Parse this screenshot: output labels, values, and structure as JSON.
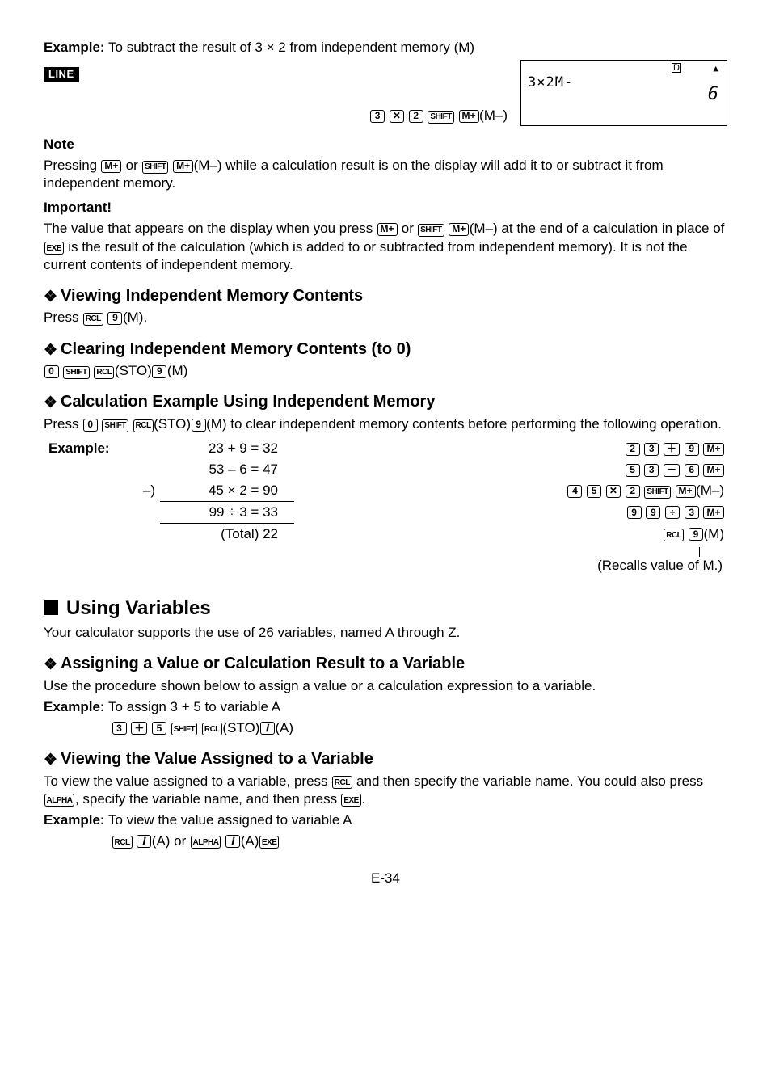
{
  "example_intro": {
    "label": "Example:",
    "text": " To subtract the result of 3 × 2 from independent memory (M)"
  },
  "line_badge": "LINE",
  "keyseq1_suffix": "(M–)",
  "screen": {
    "d": "D",
    "up": "▲",
    "line1": "3×2M-",
    "line2": "6"
  },
  "note": {
    "heading": "Note",
    "p1a": "Pressing ",
    "p1b": " or ",
    "p1c": "(M–) while a calculation result is on the display will add it to or subtract it from independent memory."
  },
  "important": {
    "heading": "Important!",
    "p1a": "The value that appears on the display when you press ",
    "p1b": " or ",
    "p1c": "(M–) at the end of a calculation in place of ",
    "p1d": " is the result of the calculation (which is added to or subtracted from independent memory). It is not the current contents of independent memory."
  },
  "sec_view_mem": {
    "title": "Viewing Independent Memory Contents",
    "body_a": "Press ",
    "body_b": "(M)."
  },
  "sec_clear_mem": {
    "title": "Clearing Independent Memory Contents (to 0)",
    "sto": "(STO)",
    "m": "(M)"
  },
  "sec_calc_ex": {
    "title": "Calculation Example Using Independent Memory",
    "intro_a": "Press ",
    "intro_b": "(STO)",
    "intro_c": "(M) to clear independent memory contents before performing the following operation."
  },
  "table": {
    "example_label": "Example:",
    "r1": {
      "eq": "23 + 9 = 32"
    },
    "r2": {
      "eq": "53 – 6 = 47"
    },
    "r3": {
      "pre": "–)",
      "eq": "45 × 2 = 90",
      "suf": "(M–)"
    },
    "r4": {
      "eq": "99 ÷ 3 = 33"
    },
    "r5": {
      "eq": "(Total)  22",
      "suf": "(M)"
    },
    "recall": "(Recalls value of M.)"
  },
  "using_vars": {
    "title": "Using Variables",
    "intro": "Your calculator supports the use of 26 variables, named A through Z."
  },
  "sec_assign": {
    "title": "Assigning a Value or Calculation Result to a Variable",
    "intro": "Use the procedure shown below to assign a value or a calculation expression to a variable.",
    "ex_label": "Example:",
    "ex_text": " To assign 3 + 5 to variable A",
    "sto": "(STO)",
    "a": "(A)"
  },
  "sec_view_var": {
    "title": "Viewing the Value Assigned to a Variable",
    "p1a": "To view the value assigned to a variable, press ",
    "p1b": " and then specify the variable name. You could also press ",
    "p1c": ", specify the variable name, and then press ",
    "p1d": ".",
    "ex_label": "Example:",
    "ex_text": " To view the value assigned to variable A",
    "a1": "(A) or ",
    "a2": "(A)"
  },
  "keys": {
    "3": "3",
    "X": "✕",
    "2": "2",
    "SHIFT": "SHIFT",
    "M+": "M+",
    "RCL": "RCL",
    "9": "9",
    "0": "0",
    "EXE": "EXE",
    "4": "4",
    "5": "5",
    "6": "6",
    "plus": "＋",
    "minus": "－",
    "div": "÷",
    "ALPHA": "ALPHA",
    "i": "𝒊"
  },
  "pagenum": "E-34",
  "chart_data": {
    "type": "table",
    "title": "Independent memory calculation example",
    "rows": [
      {
        "operation": "23 + 9",
        "result": 32,
        "memory_action": "M+"
      },
      {
        "operation": "53 - 6",
        "result": 47,
        "memory_action": "M+"
      },
      {
        "operation": "45 × 2",
        "result": 90,
        "memory_action": "M-",
        "sign": "subtract"
      },
      {
        "operation": "99 ÷ 3",
        "result": 33,
        "memory_action": "M+"
      },
      {
        "operation": "Total (RCL M)",
        "result": 22
      }
    ]
  }
}
